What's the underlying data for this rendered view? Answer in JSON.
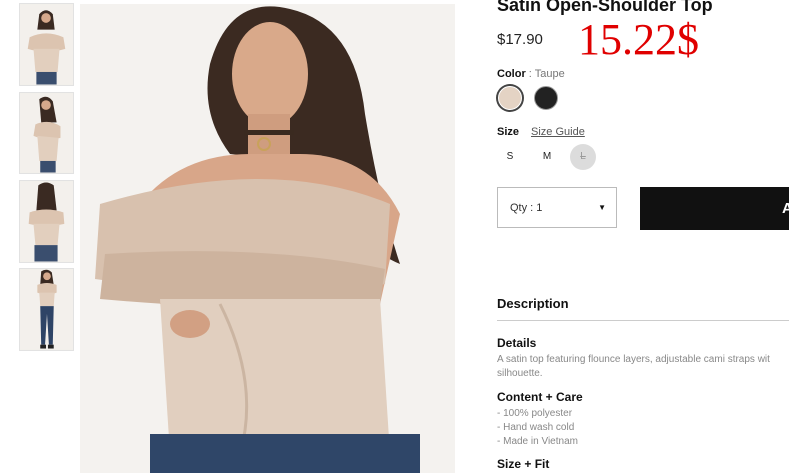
{
  "product": {
    "title": "Satin Open-Shoulder Top",
    "price": "$17.90",
    "price_annotation": "15.22$"
  },
  "color": {
    "label": "Color",
    "selected": "Taupe",
    "separator": " : ",
    "swatches": [
      {
        "name": "Taupe",
        "hex": "#e4d3c4",
        "selected": true
      },
      {
        "name": "Black",
        "hex": "#222222",
        "selected": false
      }
    ]
  },
  "size": {
    "label": "Size",
    "guide_label": "Size Guide",
    "options": [
      {
        "label": "S",
        "available": true
      },
      {
        "label": "M",
        "available": true
      },
      {
        "label": "L",
        "available": false
      }
    ]
  },
  "quantity": {
    "label": "Qty : 1"
  },
  "add_button": {
    "label": "A"
  },
  "description": {
    "heading": "Description",
    "details_heading": "Details",
    "details_lines": [
      "A satin top featuring flounce layers, adjustable cami straps wit",
      "silhouette."
    ],
    "content_heading": "Content + Care",
    "content_lines": [
      "- 100% polyester",
      "- Hand wash cold",
      "- Made in Vietnam"
    ],
    "size_fit_heading": "Size + Fit"
  },
  "gallery": {
    "thumbnails": [
      "front-view",
      "side-view",
      "back-view",
      "full-length-view"
    ],
    "main_image": "model-front-view"
  },
  "colors": {
    "price_note": "#e00000",
    "button_bg": "#111111"
  }
}
